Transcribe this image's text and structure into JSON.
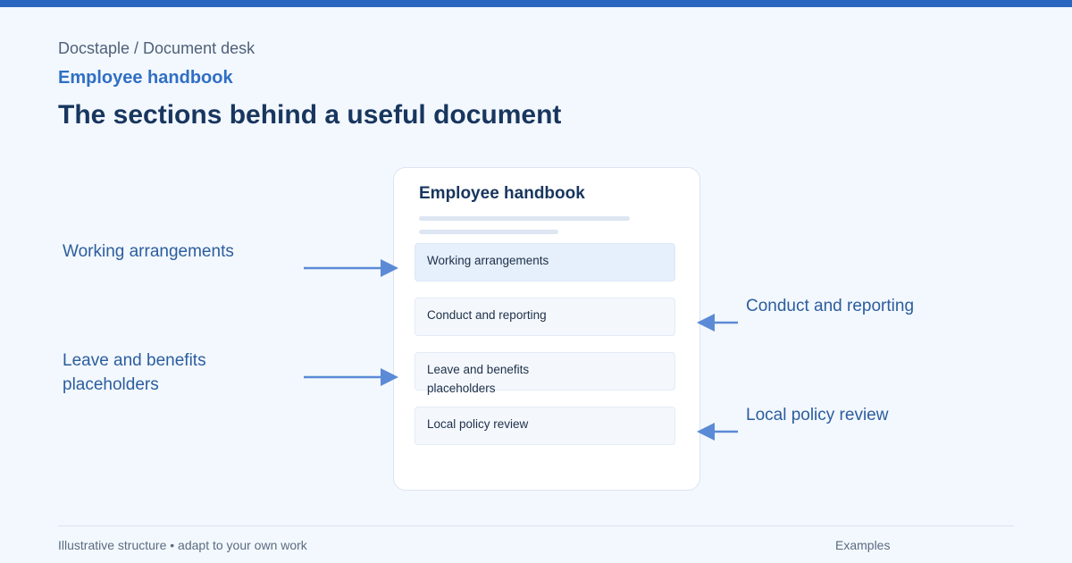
{
  "header": {
    "breadcrumb": "Docstaple / Document desk",
    "subtitle": "Employee handbook",
    "title": "The sections behind a useful document"
  },
  "document": {
    "title": "Employee handbook",
    "sections": [
      {
        "label": "Working arrangements",
        "highlighted": true
      },
      {
        "label": "Conduct and reporting",
        "highlighted": false
      },
      {
        "label": "Leave and benefits placeholders",
        "highlighted": false
      },
      {
        "label": "Local policy review",
        "highlighted": false
      }
    ]
  },
  "callouts": {
    "left": [
      "Working arrangements",
      "Leave and benefits placeholders"
    ],
    "right": [
      "Conduct and reporting",
      "Local policy review"
    ]
  },
  "footer": {
    "note": "Illustrative structure • adapt to your own work",
    "link": "Examples"
  },
  "colors": {
    "accent": "#2b67c0",
    "arrow": "#5b8ad6",
    "highlight": "#e6effc"
  }
}
